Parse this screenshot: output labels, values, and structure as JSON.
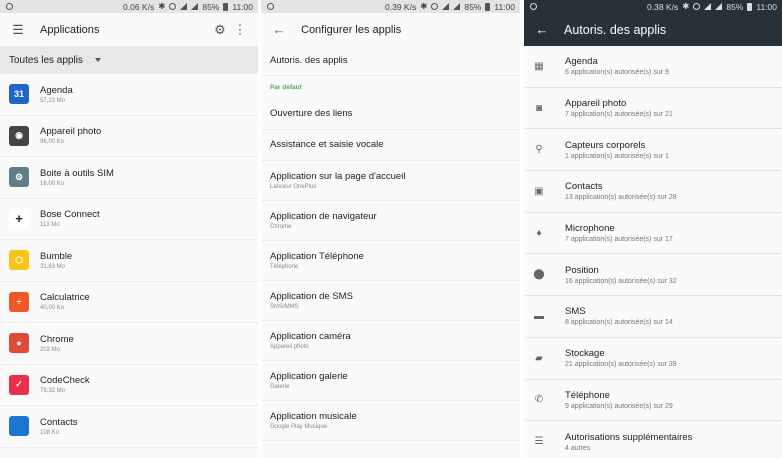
{
  "panel1": {
    "status": {
      "speed": "0.06 K/s",
      "battery": "85%",
      "time": "11:00"
    },
    "title": "Applications",
    "filter": "Toutes les applis",
    "apps": [
      {
        "name": "Agenda",
        "size": "57,23 Mo",
        "icon": "calendar-icon",
        "color": "#1e66c9",
        "glyph": "31"
      },
      {
        "name": "Appareil photo",
        "size": "96,00 Ko",
        "icon": "camera-icon",
        "color": "#444444",
        "glyph": "◉"
      },
      {
        "name": "Boite à outils SIM",
        "size": "16,00 Ko",
        "icon": "sim-toolkit-icon",
        "color": "#607d8b",
        "glyph": "⚙"
      },
      {
        "name": "Bose Connect",
        "size": "113 Mo",
        "icon": "bose-connect-icon",
        "color": "#ffffff",
        "glyph": "+"
      },
      {
        "name": "Bumble",
        "size": "31,63 Mo",
        "icon": "bumble-icon",
        "color": "#f5c518",
        "glyph": "⬡"
      },
      {
        "name": "Calculatrice",
        "size": "40,00 Ko",
        "icon": "calculator-icon",
        "color": "#ef5a24",
        "glyph": "÷"
      },
      {
        "name": "Chrome",
        "size": "202 Mo",
        "icon": "chrome-icon",
        "color": "#dd4b39",
        "glyph": "●"
      },
      {
        "name": "CodeCheck",
        "size": "79,32 Mo",
        "icon": "codecheck-icon",
        "color": "#e8304a",
        "glyph": "✓"
      },
      {
        "name": "Contacts",
        "size": "108 Ko",
        "icon": "contacts-icon",
        "color": "#1976d2",
        "glyph": "👤"
      }
    ]
  },
  "panel2": {
    "status": {
      "speed": "0.39 K/s",
      "battery": "85%",
      "time": "11:00"
    },
    "title": "Configurer les applis",
    "top_item": "Autoris. des applis",
    "section": "Par défaut",
    "items": [
      {
        "name": "Ouverture des liens",
        "sub": ""
      },
      {
        "name": "Assistance et saisie vocale",
        "sub": ""
      },
      {
        "name": "Application sur la page d'accueil",
        "sub": "Lanceur OnePlus"
      },
      {
        "name": "Application de navigateur",
        "sub": "Chrome"
      },
      {
        "name": "Application Téléphone",
        "sub": "Téléphone"
      },
      {
        "name": "Application de SMS",
        "sub": "SMS/MMS"
      },
      {
        "name": "Application caméra",
        "sub": "Appareil photo"
      },
      {
        "name": "Application galerie",
        "sub": "Galerie"
      },
      {
        "name": "Application musicale",
        "sub": "Google Play Musique"
      }
    ]
  },
  "panel3": {
    "status": {
      "speed": "0.38 K/s",
      "battery": "85%",
      "time": "11:00"
    },
    "title": "Autoris. des applis",
    "perms": [
      {
        "name": "Agenda",
        "sub": "6 application(s) autorisée(s) sur 9",
        "icon": "calendar-icon",
        "glyph": "▦"
      },
      {
        "name": "Appareil photo",
        "sub": "7 application(s) autorisée(s) sur 21",
        "icon": "camera-icon",
        "glyph": "◙"
      },
      {
        "name": "Capteurs corporels",
        "sub": "1 application(s) autorisée(s) sur 1",
        "icon": "body-sensor-icon",
        "glyph": "⚲"
      },
      {
        "name": "Contacts",
        "sub": "13 application(s) autorisée(s) sur 28",
        "icon": "contacts-icon",
        "glyph": "▣"
      },
      {
        "name": "Microphone",
        "sub": "7 application(s) autorisée(s) sur 17",
        "icon": "microphone-icon",
        "glyph": "♦"
      },
      {
        "name": "Position",
        "sub": "16 application(s) autorisée(s) sur 32",
        "icon": "location-icon",
        "glyph": "⬤"
      },
      {
        "name": "SMS",
        "sub": "8 application(s) autorisée(s) sur 14",
        "icon": "sms-icon",
        "glyph": "▬"
      },
      {
        "name": "Stockage",
        "sub": "21 application(s) autorisée(s) sur 39",
        "icon": "folder-icon",
        "glyph": "▰"
      },
      {
        "name": "Téléphone",
        "sub": "9 application(s) autorisée(s) sur 29",
        "icon": "phone-icon",
        "glyph": "✆"
      },
      {
        "name": "Autorisations supplémentaires",
        "sub": "4 autres",
        "icon": "list-icon",
        "glyph": "☰"
      }
    ]
  }
}
